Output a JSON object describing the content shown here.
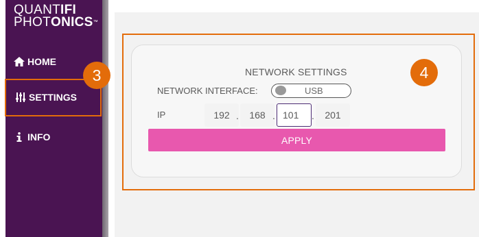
{
  "brand": {
    "line1_thin": "QUANT",
    "line1_bold": "IFI",
    "line2_thin": "PHOT",
    "line2_bold": "ONICS",
    "trademark": "™"
  },
  "sidebar": {
    "items": [
      {
        "label": "HOME",
        "icon": "home-icon"
      },
      {
        "label": "SETTINGS",
        "icon": "sliders-icon"
      },
      {
        "label": "INFO",
        "icon": "info-icon"
      }
    ]
  },
  "callouts": {
    "settings": "3",
    "card": "4"
  },
  "network": {
    "title": "NETWORK SETTINGS",
    "interface_label": "NETWORK INTERFACE:",
    "interface_value": "USB",
    "ip_label": "IP",
    "ip": [
      "192",
      "168",
      "101",
      "201"
    ],
    "separator": ".",
    "apply_label": "APPLY"
  },
  "colors": {
    "sidebar": "#4a1452",
    "callout": "#e36c0a",
    "apply": "#e858ae",
    "active_field_border": "#4b2a73"
  }
}
